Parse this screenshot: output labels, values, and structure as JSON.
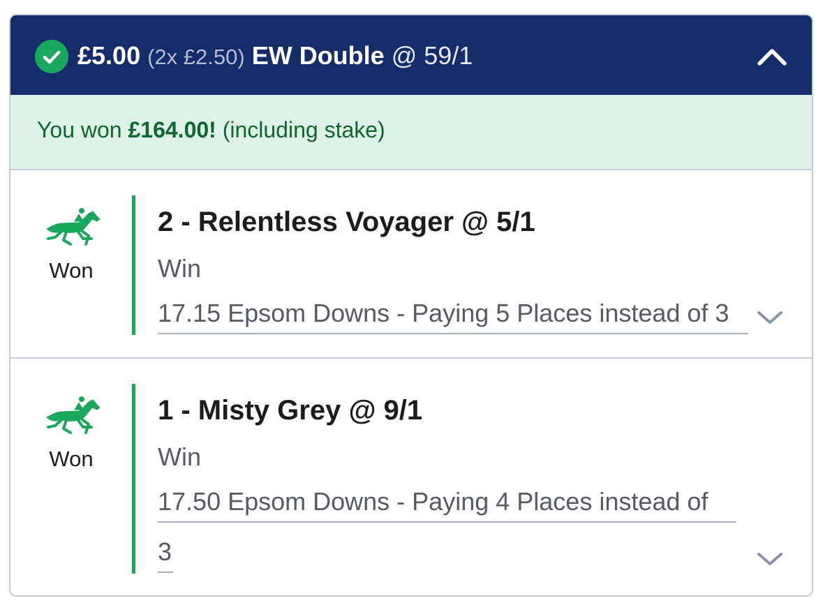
{
  "header": {
    "stake": "£5.00",
    "split": "(2x £2.50)",
    "bet_type": "EW Double",
    "odds": "@ 59/1",
    "status_icon": "check-circle-icon",
    "collapse_icon": "chevron-up-icon"
  },
  "banner": {
    "prefix": "You won",
    "amount": "£164.00!",
    "suffix": "(including stake)"
  },
  "legs": [
    {
      "result": "Won",
      "icon": "horse-racing-icon",
      "selection": "2 - Relentless Voyager @ 5/1",
      "market": "Win",
      "event_line1": "17.15 Epsom Downs - Paying 5 Places instead of 3",
      "event_line2": ""
    },
    {
      "result": "Won",
      "icon": "horse-racing-icon",
      "selection": "1 - Misty Grey @ 9/1",
      "market": "Win",
      "event_line1": "17.50 Epsom Downs - Paying 4 Places instead of",
      "event_line2": "3"
    }
  ],
  "colors": {
    "header_bg": "#152c6b",
    "won_green": "#1aa85c",
    "banner_bg": "#dff2e7",
    "banner_text": "#11652f"
  }
}
